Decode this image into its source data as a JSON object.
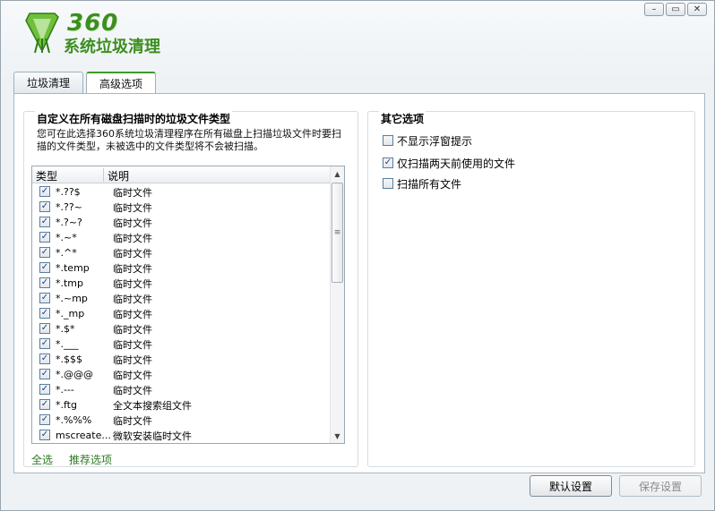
{
  "header": {
    "logo_number": "360",
    "logo_text": "系统垃圾清理"
  },
  "window_controls": {
    "minimize": "–",
    "restore": "▭",
    "close": "✕"
  },
  "tabs": [
    {
      "label": "垃圾清理",
      "active": false
    },
    {
      "label": "高级选项",
      "active": true
    }
  ],
  "left_group": {
    "title": "自定义在所有磁盘扫描时的垃圾文件类型",
    "description": "您可在此选择360系统垃圾清理程序在所有磁盘上扫描垃圾文件时要扫描的文件类型，未被选中的文件类型将不会被扫描。",
    "list": {
      "columns": [
        "类型",
        "说明"
      ],
      "rows": [
        {
          "type": "*.??$",
          "desc": "临时文件",
          "checked": true
        },
        {
          "type": "*.??~",
          "desc": "临时文件",
          "checked": true
        },
        {
          "type": "*.?~?",
          "desc": "临时文件",
          "checked": true
        },
        {
          "type": "*.~*",
          "desc": "临时文件",
          "checked": true
        },
        {
          "type": "*.^*",
          "desc": "临时文件",
          "checked": true
        },
        {
          "type": "*.temp",
          "desc": "临时文件",
          "checked": true
        },
        {
          "type": "*.tmp",
          "desc": "临时文件",
          "checked": true
        },
        {
          "type": "*.~mp",
          "desc": "临时文件",
          "checked": true
        },
        {
          "type": "*._mp",
          "desc": "临时文件",
          "checked": true
        },
        {
          "type": "*.$*",
          "desc": "临时文件",
          "checked": true
        },
        {
          "type": "*.___",
          "desc": "临时文件",
          "checked": true
        },
        {
          "type": "*.$$$",
          "desc": "临时文件",
          "checked": true
        },
        {
          "type": "*.@@@",
          "desc": "临时文件",
          "checked": true
        },
        {
          "type": "*.---",
          "desc": "临时文件",
          "checked": true
        },
        {
          "type": "*.ftg",
          "desc": "全文本搜索组文件",
          "checked": true
        },
        {
          "type": "*.%%%",
          "desc": "临时文件",
          "checked": true
        },
        {
          "type": "mscreate...",
          "desc": "微软安装临时文件",
          "checked": true
        }
      ]
    },
    "select_all_label": "全选",
    "recommended_label": "推荐选项"
  },
  "right_group": {
    "title": "其它选项",
    "options": [
      {
        "label": "不显示浮窗提示",
        "checked": false
      },
      {
        "label": "仅扫描两天前使用的文件",
        "checked": true
      },
      {
        "label": "扫描所有文件",
        "checked": false
      }
    ]
  },
  "buttons": {
    "default_label": "默认设置",
    "save_label": "保存设置"
  },
  "colors": {
    "brand_green": "#3c8f1f",
    "link_green": "#2c7a22",
    "check_blue": "#1f3f86"
  }
}
